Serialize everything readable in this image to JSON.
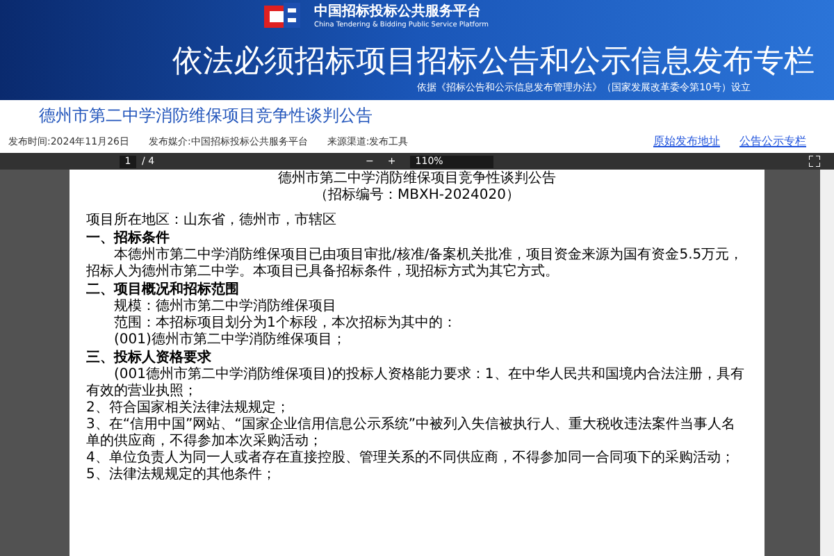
{
  "header": {
    "logo_cn": "中国招标投标公共服务平台",
    "logo_en": "China Tendering & Bidding Public Service Platform",
    "title": "依法必须招标项目招标公告和公示信息发布专栏",
    "basis": "依据《招标公告和公示信息发布管理办法》（国家发展改革委令第10号）设立"
  },
  "notice": {
    "title": "德州市第二中学消防维保项目竞争性谈判公告",
    "meta": [
      "发布时间:2024年11月26日",
      "发布媒介:中国招标投标公共服务平台",
      "来源渠道:发布工具"
    ],
    "links": [
      "原始发布地址",
      "公告公示专栏"
    ]
  },
  "viewer": {
    "page": "1",
    "pages": "/ 4",
    "zoom_out": "−",
    "zoom_in": "+",
    "zoom": "110%",
    "document": [
      {
        "kind": "title",
        "text": "德州市第二中学消防维保项目竞争性谈判公告"
      },
      {
        "kind": "subtitle",
        "text": "（招标编号：MBXH-2024020）"
      },
      {
        "kind": "para",
        "text": "项目所在地区：山东省，德州市，市辖区"
      },
      {
        "kind": "heading",
        "text": "一、招标条件"
      },
      {
        "kind": "indent",
        "text": "本德州市第二中学消防维保项目已由项目审批/核准/备案机关批准，项目资金来源为国有资金5.5万元，招标人为德州市第二中学。本项目已具备招标条件，现招标方式为其它方式。"
      },
      {
        "kind": "heading",
        "text": "二、项目概况和招标范围"
      },
      {
        "kind": "indent",
        "text": "规模：德州市第二中学消防维保项目"
      },
      {
        "kind": "indent",
        "text": "范围：本招标项目划分为1个标段，本次招标为其中的："
      },
      {
        "kind": "indent",
        "text": "(001)德州市第二中学消防维保项目；"
      },
      {
        "kind": "heading",
        "text": "三、投标人资格要求"
      },
      {
        "kind": "indent",
        "text": "(001德州市第二中学消防维保项目)的投标人资格能力要求：1、在中华人民共和国境内合法注册，具有有效的营业执照；"
      },
      {
        "kind": "para",
        "text": "2、符合国家相关法律法规规定；"
      },
      {
        "kind": "para",
        "text": "3、在“信用中国”网站、“国家企业信用信息公示系统”中被列入失信被执行人、重大税收违法案件当事人名单的供应商，不得参加本次采购活动；"
      },
      {
        "kind": "para",
        "text": "4、单位负责人为同一人或者存在直接控股、管理关系的不同供应商，不得参加同一合同项下的采购活动；"
      },
      {
        "kind": "para",
        "text": "5、法律法规规定的其他条件；"
      }
    ]
  }
}
